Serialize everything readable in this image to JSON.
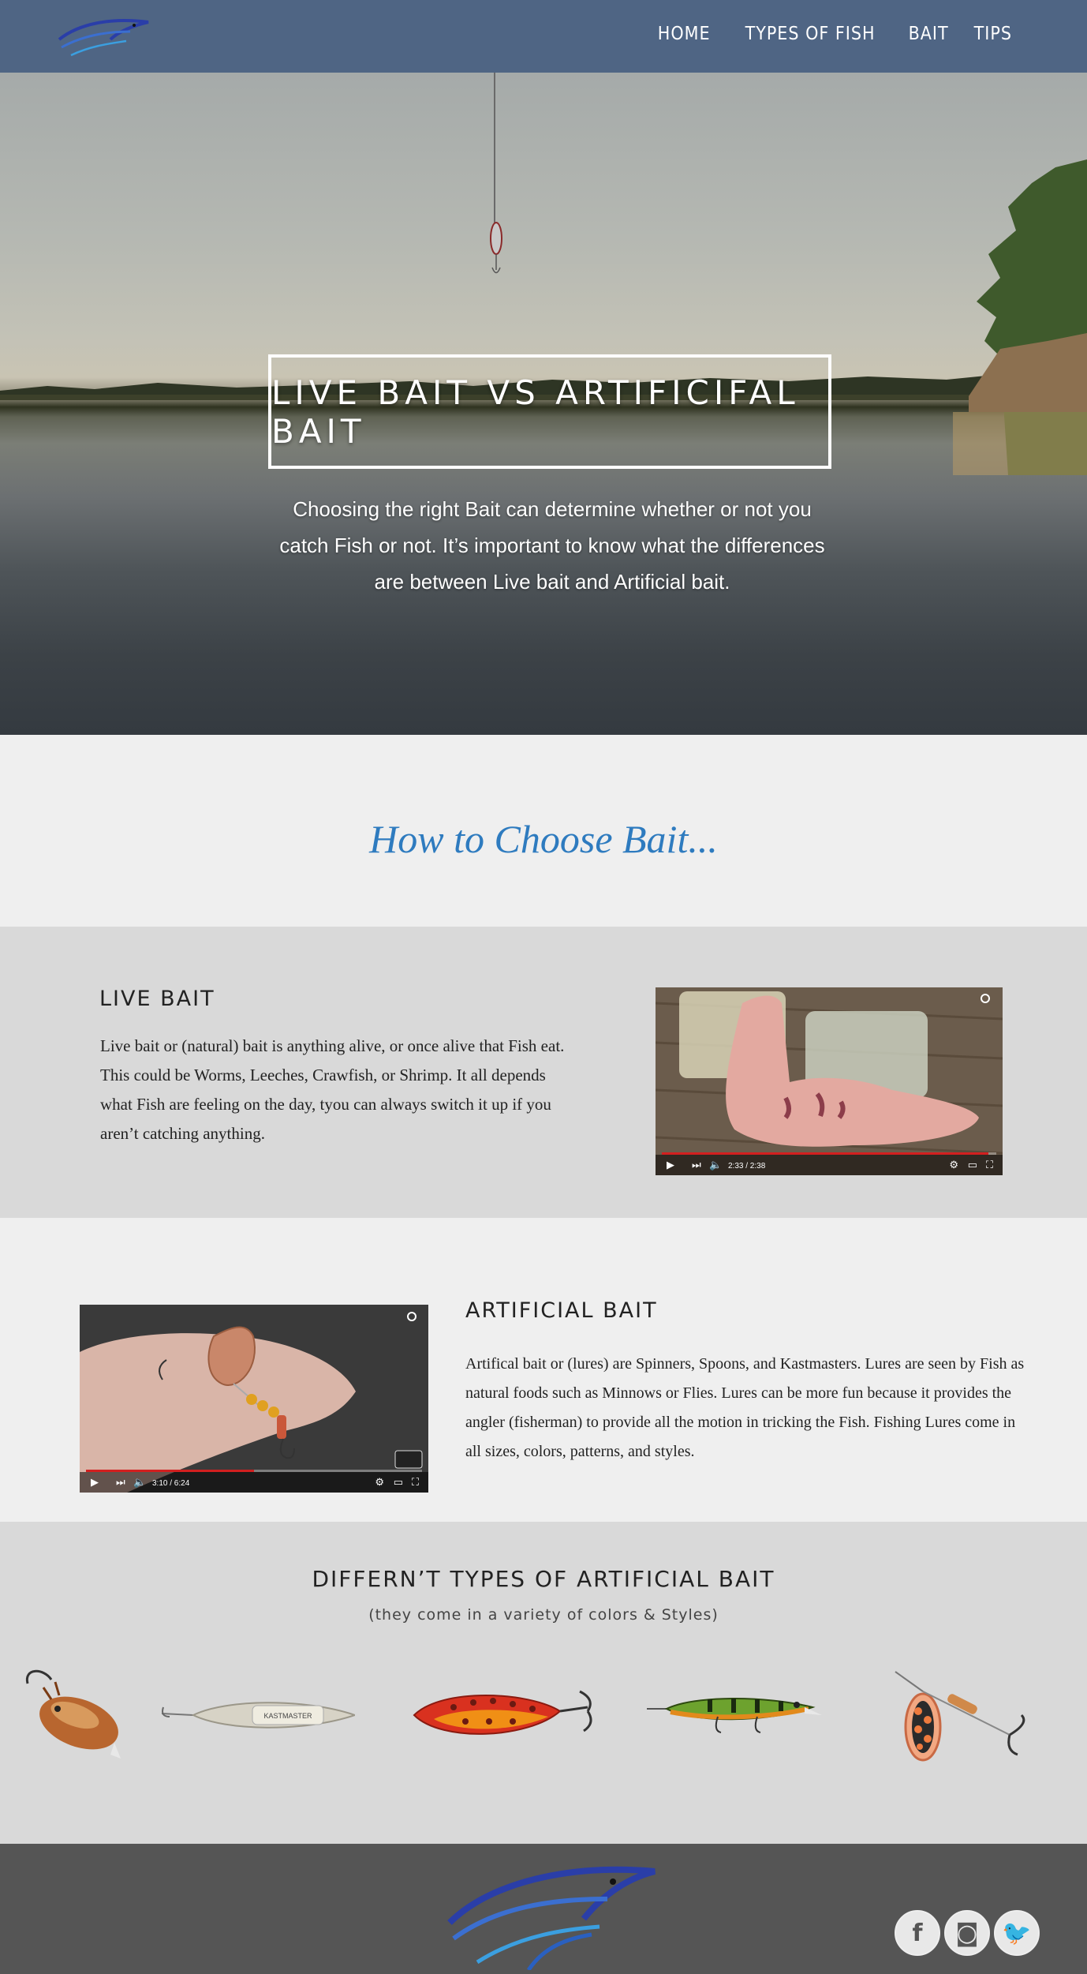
{
  "nav": {
    "items": [
      {
        "label": "HOME"
      },
      {
        "label": "TYPES OF FISH"
      },
      {
        "label": "BAIT"
      },
      {
        "label": "TIPS"
      }
    ],
    "logo_icon": "fish-logo-icon",
    "bg_color": "#4f6584"
  },
  "hero": {
    "title": "LIVE BAIT VS ARTIFICIFAL BAIT",
    "subtitle_lines": [
      "Choosing the right Bait  can determine whether or not you",
      "catch Fish or not. It’s important to know what the differences",
      "are between Live bait and Artificial bait."
    ]
  },
  "howto": {
    "heading": "How to Choose Bait...",
    "heading_color": "#2e7bbf"
  },
  "live_bait": {
    "heading": "LIVE BAIT",
    "paragraph_lines": [
      "Live bait or (natural) bait is anything alive, or once alive that Fish eat.",
      "This could be Worms, Leeches, Crawfish, or Shrimp. It all depends",
      "what Fish are feeling on the day, tyou can always switch it up if you",
      "aren’t catching anything."
    ],
    "video": {
      "time": "2:33 / 2:38",
      "progress": 0.97
    }
  },
  "artificial_bait": {
    "heading": "ARTIFICIAL BAIT",
    "paragraph_lines": [
      "Artifical bait or (lures) are Spinners, Spoons, and Kastmasters. Lures are seen by Fish as",
      "natural foods such as Minnows or Flies. Lures can be more fun because it provides the",
      "angler (fisherman) to provide all the motion in tricking the Fish. Fishing Lures come in",
      "all sizes, colors, patterns, and styles."
    ],
    "video": {
      "time": "3:10 / 6:24",
      "progress": 0.5
    }
  },
  "types": {
    "heading": "DIFFERN’T TYPES OF ARTIFICIAL BAIT",
    "subheading": "(they come in a variety of colors & Styles)",
    "lures": [
      {
        "name": "crawfish-lure"
      },
      {
        "name": "kastmaster-spoon-lure",
        "stamp": "KASTMASTER"
      },
      {
        "name": "red-spoon-lure"
      },
      {
        "name": "perch-minnow-lure"
      },
      {
        "name": "spinner-lure"
      }
    ]
  },
  "footer": {
    "logo_icon": "fish-logo-icon",
    "social": [
      {
        "icon": "facebook-icon",
        "glyph": "f"
      },
      {
        "icon": "instagram-icon",
        "glyph": "◙"
      },
      {
        "icon": "twitter-icon",
        "glyph": "🐦"
      }
    ],
    "bg_color": "#555555"
  }
}
